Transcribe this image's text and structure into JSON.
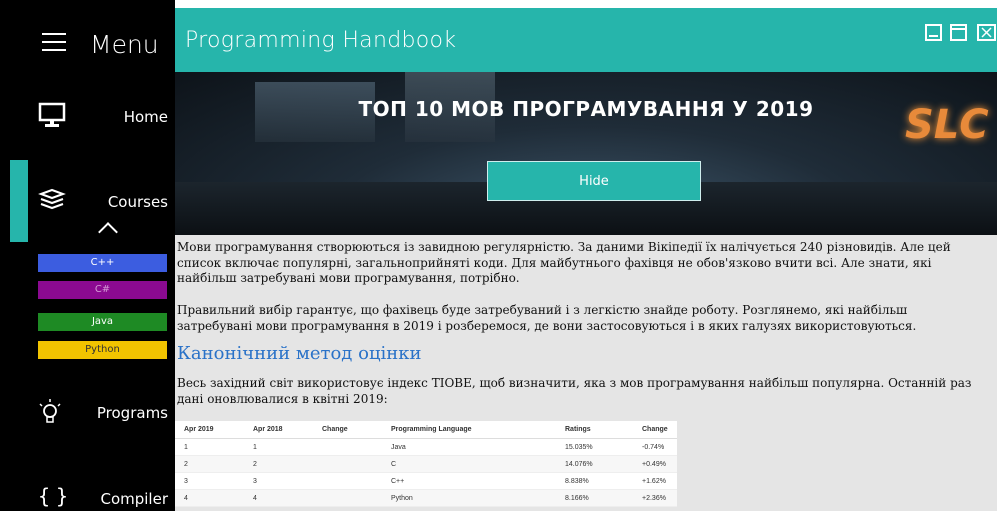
{
  "sidebar": {
    "menu_label": "Menu",
    "items": [
      {
        "label": "Home",
        "icon": "monitor-icon"
      },
      {
        "label": "Courses",
        "icon": "books-icon"
      },
      {
        "label": "Programs",
        "icon": "lightbulb-icon"
      },
      {
        "label": "Compiler",
        "icon": "braces-icon"
      }
    ],
    "courses": [
      {
        "label": "C++",
        "color": "#3c5de0"
      },
      {
        "label": "C#",
        "color": "#8b0a91"
      },
      {
        "label": "Java",
        "color": "#1e8a24"
      },
      {
        "label": "Python",
        "color": "#f2c400"
      }
    ],
    "accent_color": "#26b5ab"
  },
  "window": {
    "title": "Programming Handbook",
    "accent_color": "#26b5ab"
  },
  "hero": {
    "title": "ТОП 10 МОВ ПРОГРАМУВАННЯ У 2019",
    "button_label": "Hide",
    "logo_text": "SLC"
  },
  "article": {
    "para1": "Мови програмування створюються із завидною регулярністю. За даними Вікіпедії їх налічується 240 різновидів. Але цей список включає популярні, загальноприйняті коди. Для майбутнього фахівця не обов'язково вчити всі. Але знати, які найбільш затребувані мови програмування, потрібно.",
    "para2": "Правильний вибір гарантує, що фахівець буде затребуваний і з легкістю знайде роботу. Розглянемо, які найбільш затребувані мови програмування в 2019 і розберемося, де вони застосовуються і в яких галузях використовуються.",
    "heading": "Канонічний метод оцінки",
    "para3": "Весь західний світ використовує індекс TIOBE, щоб визначити, яка з мов програмування найбільш популярна. Останній раз дані оновлювалися в квітні 2019:"
  },
  "table": {
    "headers": [
      "Apr 2019",
      "Apr 2018",
      "Change",
      "Programming Language",
      "Ratings",
      "Change"
    ],
    "rows": [
      [
        "1",
        "1",
        "",
        "Java",
        "15.035%",
        "-0.74%"
      ],
      [
        "2",
        "2",
        "",
        "C",
        "14.076%",
        "+0.49%"
      ],
      [
        "3",
        "3",
        "",
        "C++",
        "8.838%",
        "+1.62%"
      ],
      [
        "4",
        "4",
        "",
        "Python",
        "8.166%",
        "+2.36%"
      ]
    ]
  }
}
